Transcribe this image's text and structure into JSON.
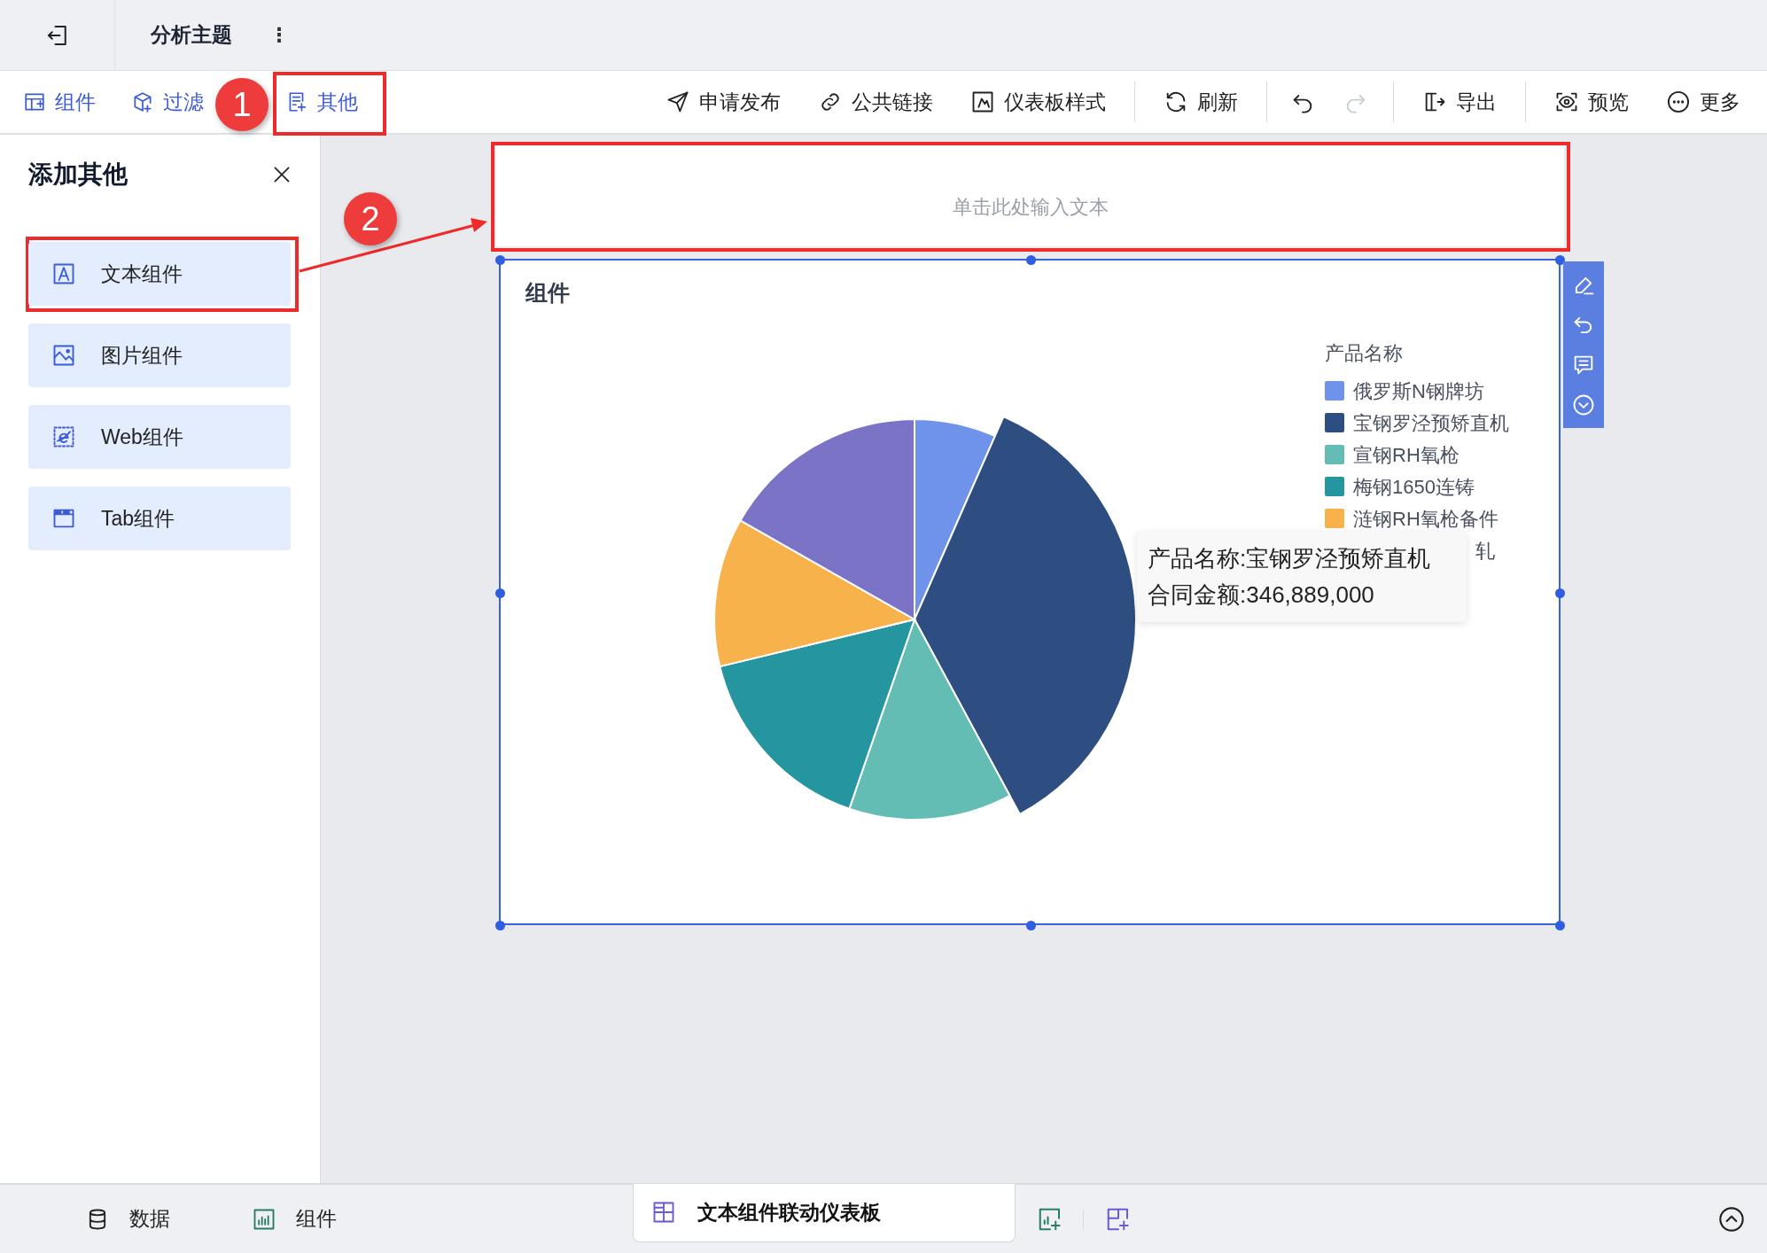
{
  "header": {
    "title": "分析主题",
    "menu_glyph": "⋮"
  },
  "toolbar": {
    "left": [
      {
        "label": "组件"
      },
      {
        "label": "过滤"
      },
      {
        "label": "其他"
      }
    ],
    "right": [
      {
        "kind": "button",
        "label": "申请发布"
      },
      {
        "kind": "button",
        "label": "公共链接"
      },
      {
        "kind": "button",
        "label": "仪表板样式"
      },
      {
        "kind": "divider"
      },
      {
        "kind": "button",
        "label": "刷新"
      },
      {
        "kind": "divider"
      },
      {
        "kind": "undo",
        "disabled": false
      },
      {
        "kind": "redo",
        "disabled": true
      },
      {
        "kind": "divider"
      },
      {
        "kind": "button",
        "label": "导出"
      },
      {
        "kind": "divider"
      },
      {
        "kind": "button",
        "label": "预览"
      },
      {
        "kind": "button",
        "label": "更多"
      }
    ]
  },
  "panel": {
    "title": "添加其他",
    "items": [
      {
        "label": "文本组件"
      },
      {
        "label": "图片组件"
      },
      {
        "label": "Web组件"
      },
      {
        "label": "Tab组件"
      }
    ]
  },
  "canvas": {
    "text_placeholder": "单击此处输入文本",
    "chart": {
      "title": "组件",
      "legend_title": "产品名称",
      "legend": [
        {
          "label": "俄罗斯N钢牌坊",
          "color": "#6f93ea",
          "covered": false
        },
        {
          "label": "宝钢罗泾预矫直机",
          "color": "#2e4d80",
          "covered": false
        },
        {
          "label": "宣钢RH氧枪",
          "color": "#63bdb5",
          "covered": false
        },
        {
          "label": "梅钢1650连铸",
          "color": "#2596a0",
          "covered": false
        },
        {
          "label": "涟钢RH氧枪备件",
          "color": "#f8b24c",
          "covered": false
        },
        {
          "label": "轧",
          "color": "#7b74c6",
          "covered": true
        }
      ],
      "tooltip": [
        "产品名称:宝钢罗泾预矫直机",
        "合同金额:346,889,000"
      ]
    }
  },
  "annotations": [
    "1",
    "2"
  ],
  "bottom": {
    "tabs": [
      {
        "label": "数据"
      },
      {
        "label": "组件"
      }
    ],
    "sheet": {
      "label": "文本组件联动仪表板",
      "selected": true
    }
  }
}
